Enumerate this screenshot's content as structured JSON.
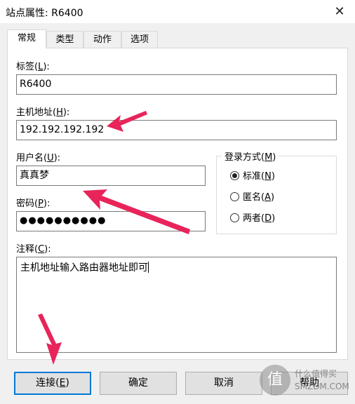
{
  "window": {
    "title": "站点属性: R6400",
    "close_glyph": "✕"
  },
  "tabs": [
    {
      "label": "常规",
      "active": true
    },
    {
      "label": "类型"
    },
    {
      "label": "动作"
    },
    {
      "label": "选项"
    }
  ],
  "fields": {
    "label": {
      "text": "标签(",
      "key": "L",
      "tail": "):",
      "value": "R6400"
    },
    "host": {
      "text": "主机地址(",
      "key": "H",
      "tail": "):",
      "value": "192.192.192.192"
    },
    "username": {
      "text": "用户名(",
      "key": "U",
      "tail": "):",
      "value": "真真梦"
    },
    "password": {
      "text": "密码(",
      "key": "P",
      "tail": "):",
      "value": "●●●●●●●●●●"
    },
    "comment": {
      "text": "注释(",
      "key": "C",
      "tail": "):",
      "value": "主机地址输入路由器地址即可"
    }
  },
  "login_method": {
    "legend": {
      "text": "登录方式(",
      "key": "M",
      "tail": ")"
    },
    "options": [
      {
        "text": "标准(",
        "key": "N",
        "tail": ")",
        "checked": true
      },
      {
        "text": "匿名(",
        "key": "A",
        "tail": ")"
      },
      {
        "text": "两者(",
        "key": "D",
        "tail": ")"
      }
    ]
  },
  "buttons": {
    "connect": {
      "text": "连接(",
      "key": "E",
      "tail": ")"
    },
    "ok": {
      "text": "确定"
    },
    "cancel": {
      "text": "取消"
    },
    "help": {
      "text": "帮助"
    }
  },
  "watermark": {
    "logo_char": "值",
    "line1": "什么值得买",
    "line2": "SMZDM.COM"
  },
  "colors": {
    "arrow": "#e8245a",
    "focus": "#0078d7"
  }
}
